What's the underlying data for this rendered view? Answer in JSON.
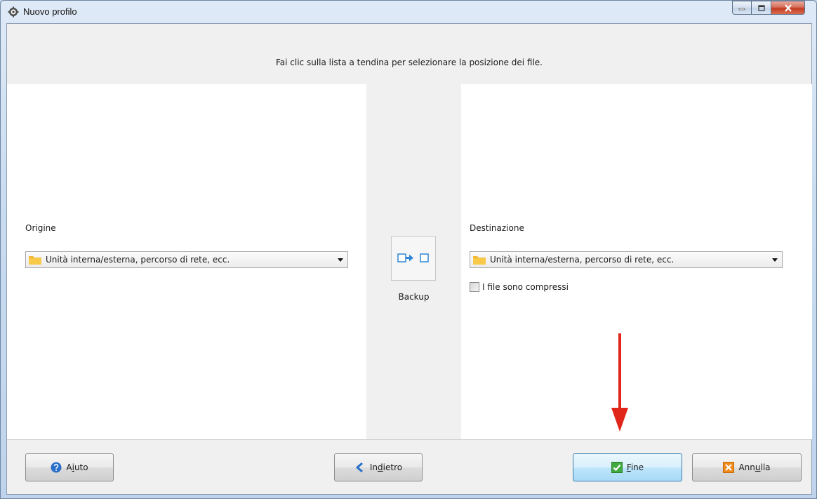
{
  "window": {
    "title": "Nuovo profilo",
    "accent_color": "#3c7fb1"
  },
  "hint": "Fai clic sulla lista a tendina per selezionare la posizione dei file.",
  "source": {
    "label": "Origine",
    "combo_value": "Unità interna/esterna, percorso di rete, ecc.",
    "icon": "folder-icon"
  },
  "middle": {
    "icon": "backup-arrow-icon",
    "label": "Backup"
  },
  "destination": {
    "label": "Destinazione",
    "combo_value": "Unità interna/esterna, percorso di rete, ecc.",
    "icon": "folder-icon",
    "compressed_checkbox_label": "I file sono compressi",
    "compressed_checked": false
  },
  "buttons": {
    "help": {
      "pre": "A",
      "ul": "i",
      "post": "uto"
    },
    "back": {
      "pre": "In",
      "ul": "d",
      "post": "ietro"
    },
    "finish": {
      "pre": "",
      "ul": "F",
      "post": "ine"
    },
    "cancel": {
      "pre": "Ann",
      "ul": "u",
      "post": "lla"
    }
  },
  "annotation": {
    "arrow_color": "#e0251b"
  }
}
